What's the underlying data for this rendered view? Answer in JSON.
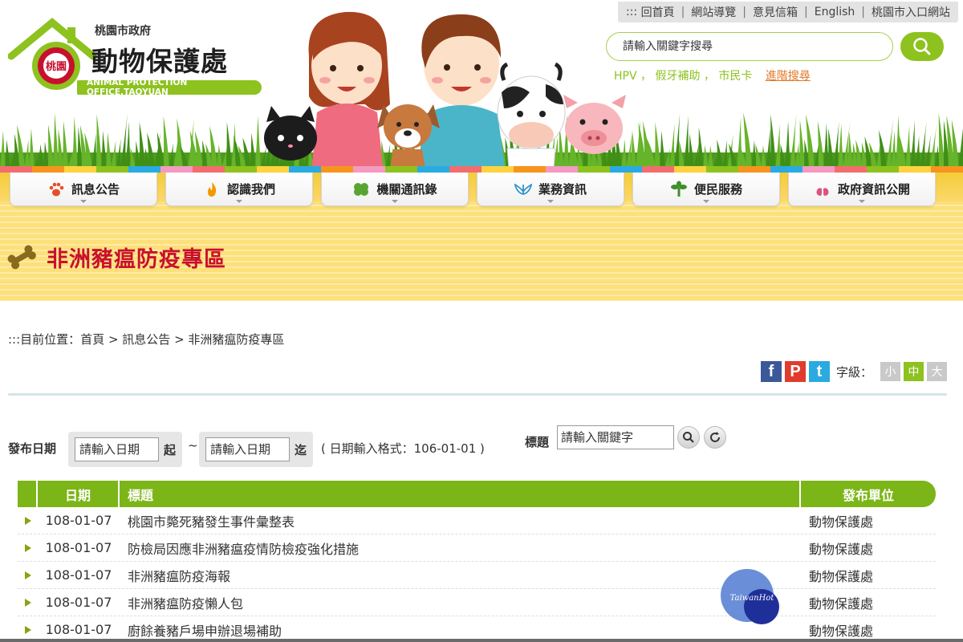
{
  "topbar": {
    "prefix": ":::",
    "links": [
      "回首頁",
      "網站導覽",
      "意見信箱",
      "English",
      "桃園市入口網站"
    ]
  },
  "logo": {
    "org": "桃園市政府",
    "name": "動物保護處",
    "emblem_text": "桃園",
    "subtitle": "ANIMAL PROTECTION OFFICE,TAOYUAN"
  },
  "search": {
    "placeholder": "請輸入關鍵字搜尋",
    "hotwords": [
      "HPV",
      "假牙補助",
      "市民卡"
    ],
    "advanced_label": "進階搜尋"
  },
  "strip_colors": [
    "#f26d6d",
    "#f7941d",
    "#ffd23f",
    "#8dc21f",
    "#29abe2",
    "#f49ac1",
    "#f26d6d",
    "#8dc21f",
    "#ffd23f",
    "#29abe2",
    "#f7941d",
    "#f49ac1",
    "#8dc21f",
    "#29abe2",
    "#f26d6d",
    "#ffd23f",
    "#f7941d",
    "#f49ac1",
    "#8dc21f",
    "#29abe2",
    "#f26d6d",
    "#ffd23f",
    "#8dc21f",
    "#f7941d",
    "#29abe2",
    "#f49ac1",
    "#f26d6d",
    "#8dc21f",
    "#ffd23f",
    "#f7941d"
  ],
  "nav": [
    {
      "label": "訊息公告",
      "icon": "paw-icon",
      "color": "#e94e2a"
    },
    {
      "label": "認識我們",
      "icon": "flame-icon",
      "color": "#f39800"
    },
    {
      "label": "機關通訊錄",
      "icon": "clover-icon",
      "color": "#5aa532"
    },
    {
      "label": "業務資訊",
      "icon": "wings-icon",
      "color": "#2a8fc9"
    },
    {
      "label": "便民服務",
      "icon": "sprout-icon",
      "color": "#3f8f2b"
    },
    {
      "label": "政府資訊公開",
      "icon": "lungs-icon",
      "color": "#d9557d"
    }
  ],
  "page": {
    "title": "非洲豬瘟防疫專區",
    "title_icon": "bone-icon"
  },
  "breadcrumb": {
    "prefix": ":::目前位置：",
    "items": [
      "首頁",
      "訊息公告",
      "非洲豬瘟防疫專區"
    ],
    "sep": " > "
  },
  "share": {
    "facebook": "f",
    "plurk": "P",
    "twitter": "t",
    "font_label": "字級：",
    "sizes": [
      "小",
      "中",
      "大"
    ],
    "active_size": 1
  },
  "filter": {
    "date_label": "發布日期",
    "start_placeholder": "請輸入日期",
    "start_suffix": "起",
    "tilde": "~",
    "end_placeholder": "請輸入日期",
    "end_suffix": "迄",
    "format_hint": "( 日期輸入格式：106-01-01 )",
    "title_label": "標題",
    "keyword_placeholder": "請輸入關鍵字"
  },
  "table": {
    "headers": [
      "日期",
      "標題",
      "發布單位"
    ],
    "rows": [
      {
        "date": "108-01-07",
        "title": "桃園市斃死豬發生事件彙整表",
        "unit": "動物保護處"
      },
      {
        "date": "108-01-07",
        "title": "防檢局因應非洲豬瘟疫情防檢疫強化措施",
        "unit": "動物保護處"
      },
      {
        "date": "108-01-07",
        "title": "非洲豬瘟防疫海報",
        "unit": "動物保護處"
      },
      {
        "date": "108-01-07",
        "title": "非洲豬瘟防疫懶人包",
        "unit": "動物保護處"
      },
      {
        "date": "108-01-07",
        "title": "廚餘養豬戶場申辦退場補助",
        "unit": "動物保護處"
      }
    ]
  },
  "watermark": {
    "text": "TaiwanHot"
  },
  "colors": {
    "accent_green": "#7cb518",
    "title_red": "#c8102e",
    "nav_band_yellow": "#fde07a",
    "link_orange": "#e07a2a"
  }
}
